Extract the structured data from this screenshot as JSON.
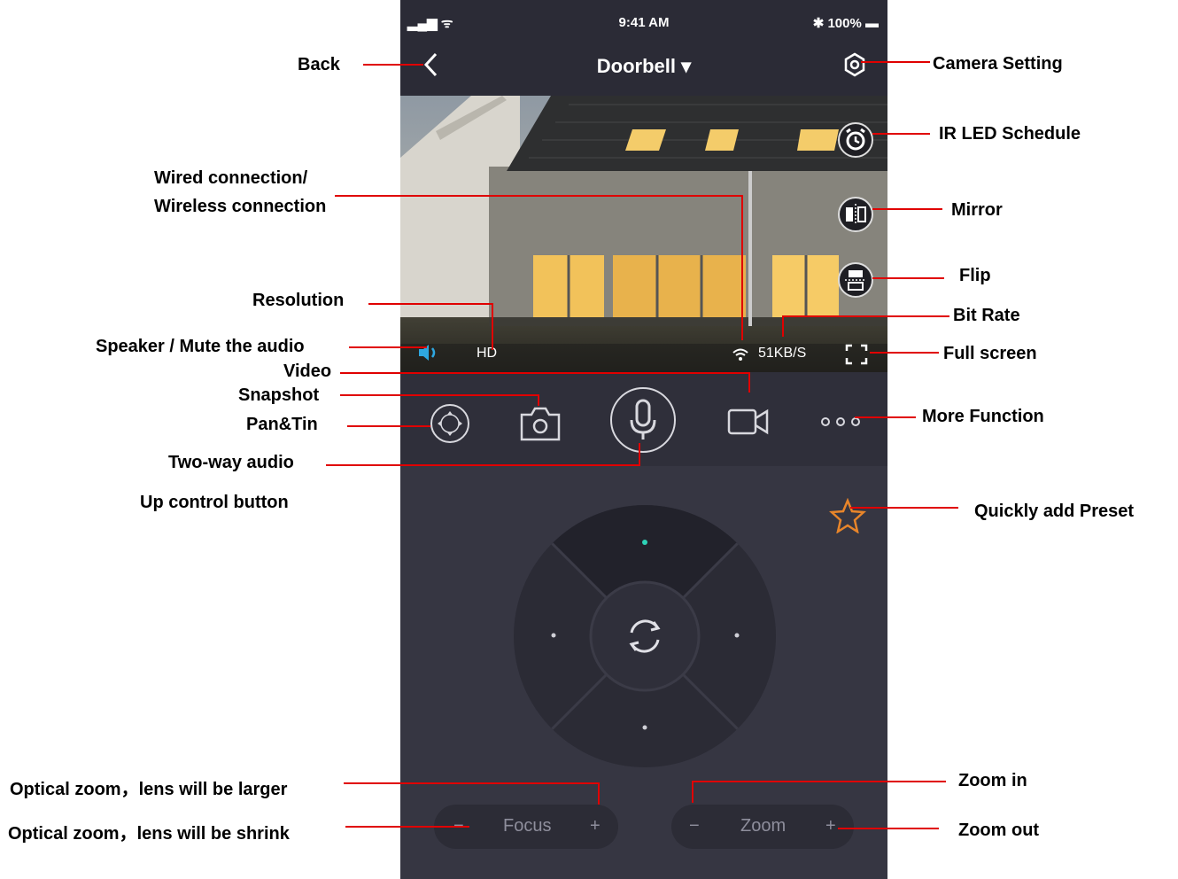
{
  "status_bar": {
    "signal": "▂▄▆ ᯤ",
    "time": "9:41 AM",
    "battery": "✱ 100% ▬"
  },
  "nav": {
    "title": "Doorbell ▾"
  },
  "video": {
    "resolution": "HD",
    "bitrate": "51KB/S"
  },
  "ptz": {
    "focus_label": "Focus",
    "zoom_label": "Zoom",
    "minus": "−",
    "plus": "+"
  },
  "labels": {
    "back": "Back",
    "camera_setting": "Camera Setting",
    "ir_led": "IR LED Schedule",
    "wired1": "Wired connection/",
    "wired2": "Wireless connection",
    "mirror": "Mirror",
    "flip": "Flip",
    "resolution": "Resolution",
    "bitrate": "Bit Rate",
    "speaker": "Speaker / Mute the audio",
    "fullscreen": "Full screen",
    "video": "Video",
    "snapshot": "Snapshot",
    "pantilt": "Pan&Tin",
    "more": "More Function",
    "twoway": "Two-way audio",
    "up": "Up control button",
    "preset": "Quickly add Preset",
    "optlarger": "Optical zoom，lens will be larger",
    "optshrink": "Optical zoom，lens will be shrink",
    "zoomin": "Zoom in",
    "zoomout": "Zoom out"
  },
  "colors": {
    "annotation": "#e00000",
    "accent": "#2ed3b7",
    "star": "#e8852a"
  }
}
